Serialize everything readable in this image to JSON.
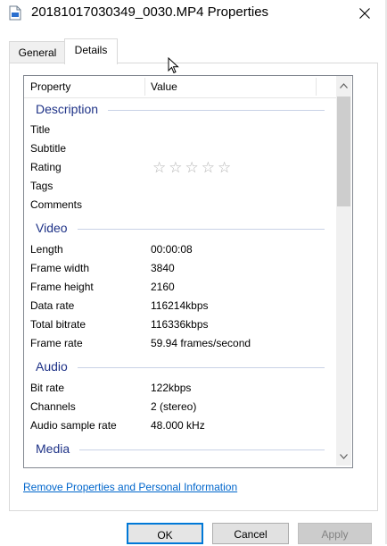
{
  "window": {
    "title": "20181017030349_0030.MP4 Properties"
  },
  "tabs": [
    {
      "label": "General",
      "active": false
    },
    {
      "label": "Details",
      "active": true
    }
  ],
  "table": {
    "columns": [
      "Property",
      "Value"
    ],
    "groups": {
      "description": "Description",
      "video": "Video",
      "audio": "Audio",
      "media": "Media"
    },
    "rows": {
      "title": {
        "property": "Title",
        "value": ""
      },
      "subtitle": {
        "property": "Subtitle",
        "value": ""
      },
      "rating": {
        "property": "Rating",
        "value": "0 of 5 stars"
      },
      "tags": {
        "property": "Tags",
        "value": ""
      },
      "comments": {
        "property": "Comments",
        "value": ""
      },
      "length": {
        "property": "Length",
        "value": "00:00:08"
      },
      "frame_width": {
        "property": "Frame width",
        "value": "3840"
      },
      "frame_height": {
        "property": "Frame height",
        "value": "2160"
      },
      "data_rate": {
        "property": "Data rate",
        "value": "116214kbps"
      },
      "total_bitrate": {
        "property": "Total bitrate",
        "value": "116336kbps"
      },
      "frame_rate": {
        "property": "Frame rate",
        "value": "59.94 frames/second"
      },
      "bit_rate": {
        "property": "Bit rate",
        "value": "122kbps"
      },
      "channels": {
        "property": "Channels",
        "value": "2 (stereo)"
      },
      "audio_sample_rate": {
        "property": "Audio sample rate",
        "value": "48.000 kHz"
      }
    }
  },
  "link": "Remove Properties and Personal Information",
  "buttons": {
    "ok": "OK",
    "cancel": "Cancel",
    "apply": "Apply"
  },
  "colors": {
    "group_heading": "#1e3287",
    "link": "#0066cc",
    "default_button_border": "#0078d7"
  }
}
